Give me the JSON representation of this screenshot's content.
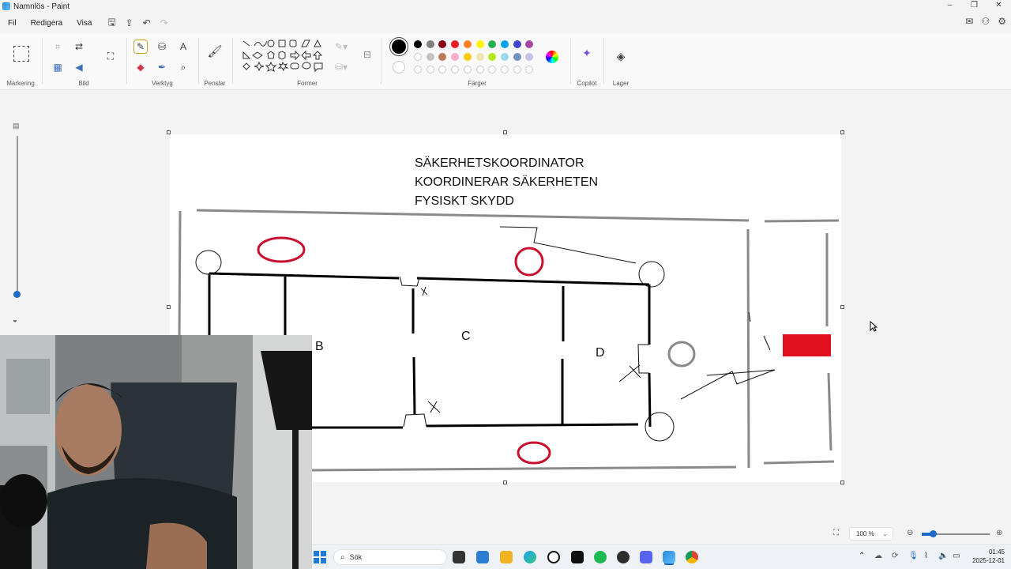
{
  "window": {
    "title": "Namnlös - Paint",
    "controls": [
      "–",
      "❐",
      "✕"
    ]
  },
  "menu": [
    "Fil",
    "Redigera",
    "Visa"
  ],
  "ribbon": {
    "groups": [
      "Markering",
      "Bild",
      "Verktyg",
      "Penslar",
      "Former",
      "Färger",
      "Copilot",
      "Lager"
    ]
  },
  "colors": {
    "row1": [
      "#000000",
      "#7f7f7f",
      "#880015",
      "#ed1c24",
      "#ff7f27",
      "#fff200",
      "#22b14c",
      "#00a2e8",
      "#3f48cc",
      "#a349a4"
    ],
    "row2": [
      "#ffffff",
      "#c3c3c3",
      "#b97a57",
      "#ffaec9",
      "#ffc90e",
      "#efe4b0",
      "#b5e61d",
      "#99d9ea",
      "#7092be",
      "#c8bfe7"
    ],
    "accent": "#1b6ac9",
    "drawing_red": "#d0021b"
  },
  "canvas": {
    "text_line1": "SÄKERHETSKOORDINATOR",
    "text_line2": "KOORDINERAR SÄKERHETEN",
    "text_line3": "FYSISKT SKYDD",
    "label_b": "B",
    "label_c": "C",
    "label_d": "D"
  },
  "statusbar": {
    "zoom": "100 %"
  },
  "taskbar": {
    "search_placeholder": "Sök",
    "time": "01:45",
    "date": "2025-12-01"
  }
}
